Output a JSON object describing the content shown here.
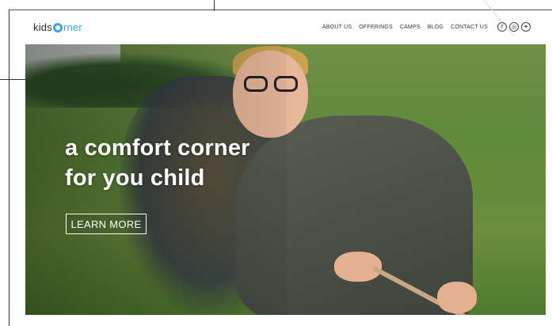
{
  "brand": {
    "prefix": "kids",
    "suffix": "rner"
  },
  "nav": {
    "items": [
      "ABOUT US",
      "OFFERINGS",
      "CAMPS",
      "BLOG",
      "CONTACT US"
    ]
  },
  "social": {
    "icons": [
      "facebook-icon",
      "dribbble-icon",
      "twitter-icon"
    ]
  },
  "hero": {
    "headline_line1": "a comfort corner",
    "headline_line2": "for you child",
    "cta_label": "LEARN MORE"
  },
  "colors": {
    "brand": "#37a6d8",
    "text_dark": "#333333",
    "hero_text": "#ffffff"
  }
}
